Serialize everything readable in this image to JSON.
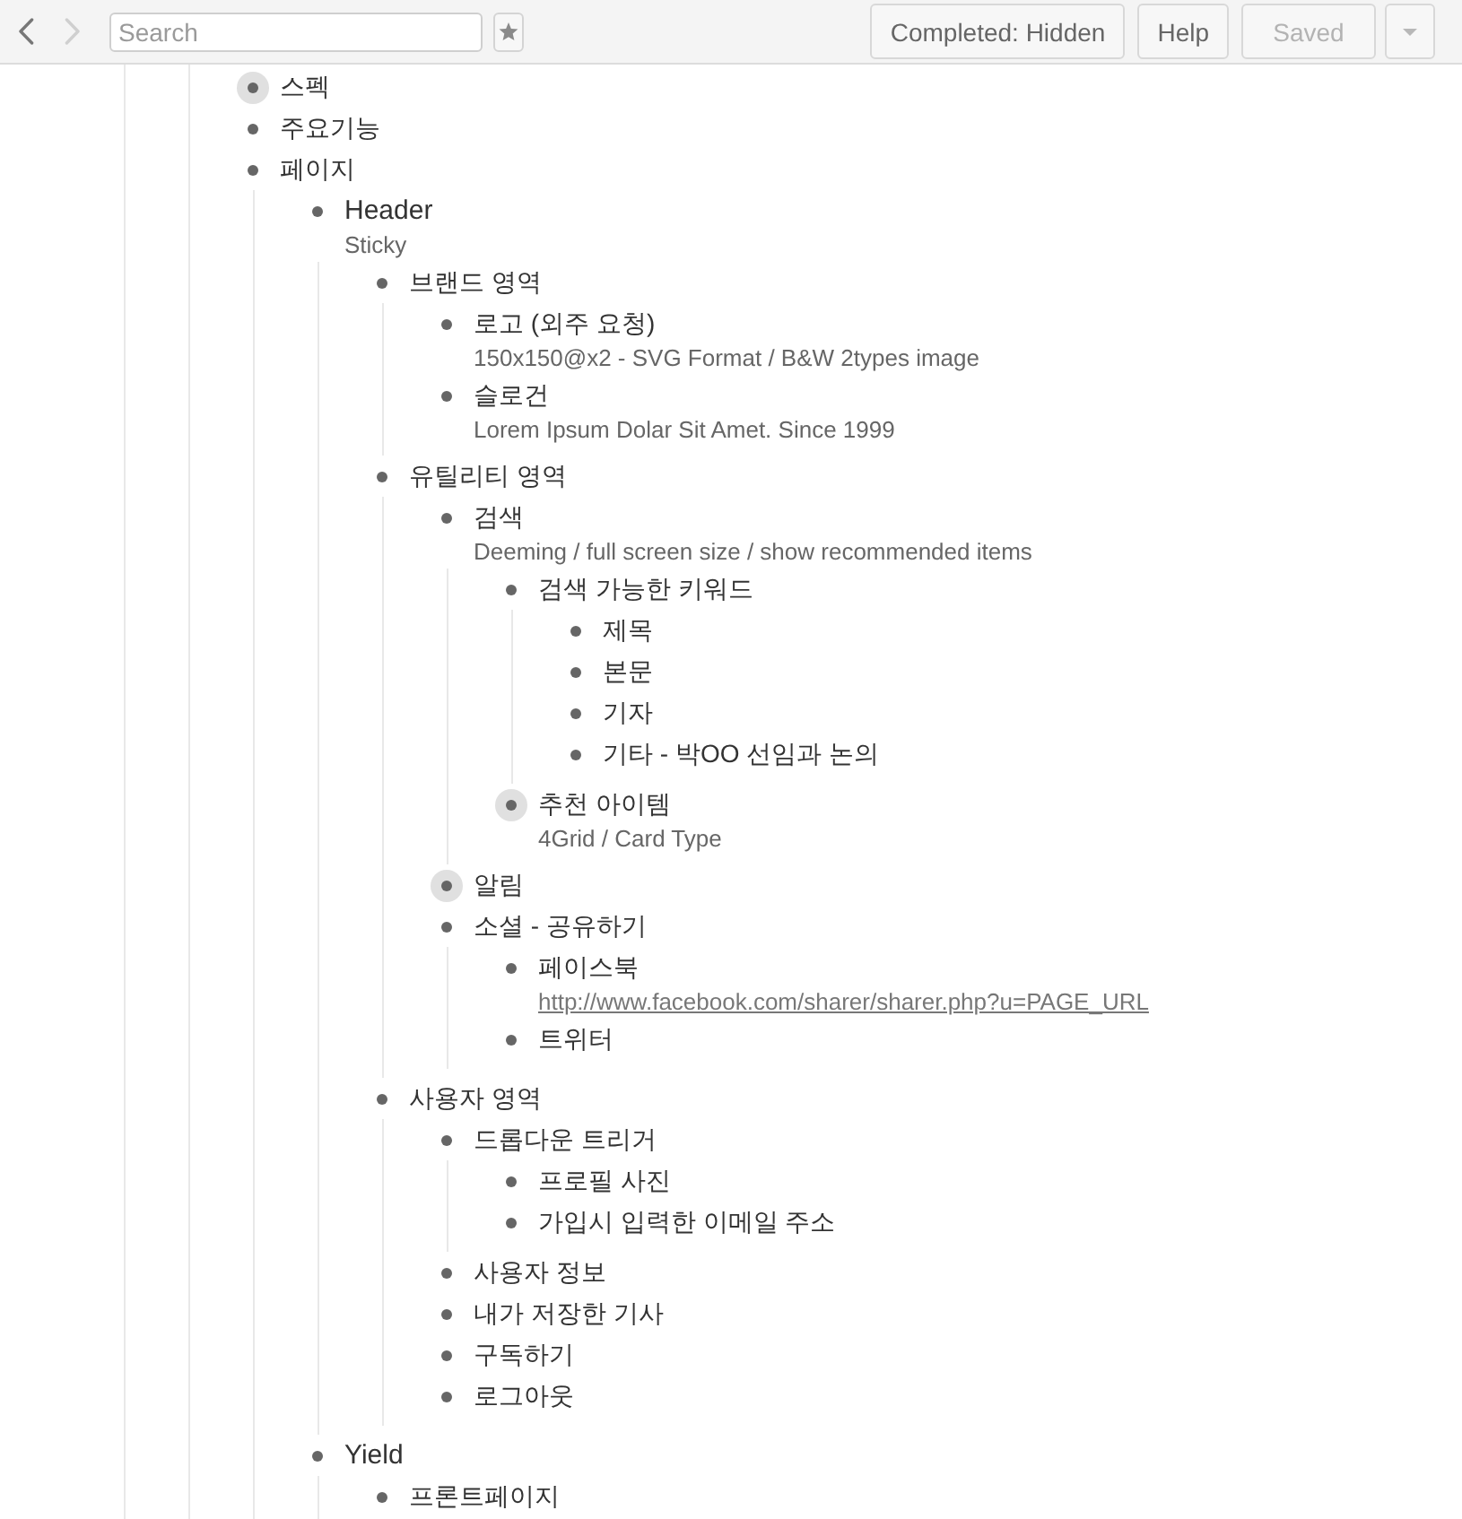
{
  "toolbar": {
    "back": {
      "disabled": false
    },
    "forward": {
      "disabled": true
    },
    "search": {
      "placeholder": "Search"
    },
    "buttons": [
      {
        "label": "Completed: Hidden",
        "disabled": false
      },
      {
        "label": "Help",
        "disabled": false
      },
      {
        "label": "Saved",
        "disabled": true
      }
    ]
  },
  "outline": {
    "items": [
      {
        "text": "스펙",
        "kind": "text",
        "collapsed": true
      },
      {
        "text": "주요기능",
        "kind": "text",
        "collapsed": false
      },
      {
        "text": "페이지",
        "kind": "text",
        "collapsed": false,
        "children": [
          {
            "text": "Header",
            "kind": "heading",
            "collapsed": false,
            "note": "Sticky",
            "children": [
              {
                "text": "브랜드 영역",
                "kind": "text",
                "collapsed": false,
                "children": [
                  {
                    "text": "로고 (외주 요청)",
                    "kind": "text",
                    "collapsed": false,
                    "note": "150x150@x2 - SVG Format / B&W 2types image"
                  },
                  {
                    "text": "슬로건",
                    "kind": "text",
                    "collapsed": false,
                    "note": "Lorem Ipsum Dolar Sit Amet. Since 1999"
                  }
                ]
              },
              {
                "text": "유틸리티 영역",
                "kind": "text",
                "collapsed": false,
                "children": [
                  {
                    "text": "검색",
                    "kind": "text",
                    "collapsed": false,
                    "note": "Deeming / full screen size / show recommended items",
                    "children": [
                      {
                        "text": "검색 가능한 키워드",
                        "kind": "text",
                        "collapsed": false,
                        "children": [
                          {
                            "text": "제목",
                            "kind": "text",
                            "collapsed": false
                          },
                          {
                            "text": "본문",
                            "kind": "text",
                            "collapsed": false
                          },
                          {
                            "text": "기자",
                            "kind": "text",
                            "collapsed": false
                          },
                          {
                            "text": "기타 - 박OO 선임과 논의",
                            "kind": "text",
                            "collapsed": false
                          }
                        ]
                      },
                      {
                        "text": "추천 아이템",
                        "kind": "text",
                        "collapsed": true,
                        "note": "4Grid / Card Type"
                      }
                    ]
                  },
                  {
                    "text": "알림",
                    "kind": "text",
                    "collapsed": true
                  },
                  {
                    "text": "소셜 - 공유하기",
                    "kind": "text",
                    "collapsed": false,
                    "children": [
                      {
                        "text": "페이스북",
                        "kind": "text",
                        "collapsed": false,
                        "link": "http://www.facebook.com/sharer/sharer.php?u=PAGE_URL"
                      },
                      {
                        "text": "트위터",
                        "kind": "text",
                        "collapsed": false
                      }
                    ]
                  }
                ]
              },
              {
                "text": "사용자 영역",
                "kind": "text",
                "collapsed": false,
                "children": [
                  {
                    "text": "드롭다운 트리거",
                    "kind": "text",
                    "collapsed": false,
                    "children": [
                      {
                        "text": "프로필 사진",
                        "kind": "text",
                        "collapsed": false
                      },
                      {
                        "text": "가입시 입력한 이메일 주소",
                        "kind": "text",
                        "collapsed": false
                      }
                    ]
                  },
                  {
                    "text": "사용자 정보",
                    "kind": "text",
                    "collapsed": false
                  },
                  {
                    "text": "내가 저장한 기사",
                    "kind": "text",
                    "collapsed": false
                  },
                  {
                    "text": "구독하기",
                    "kind": "text",
                    "collapsed": false
                  },
                  {
                    "text": "로그아웃",
                    "kind": "text",
                    "collapsed": false
                  }
                ]
              }
            ]
          },
          {
            "text": "Yield",
            "kind": "heading",
            "collapsed": false,
            "children": [
              {
                "text": "프론트페이지",
                "kind": "text",
                "collapsed": false
              }
            ]
          }
        ]
      }
    ]
  }
}
